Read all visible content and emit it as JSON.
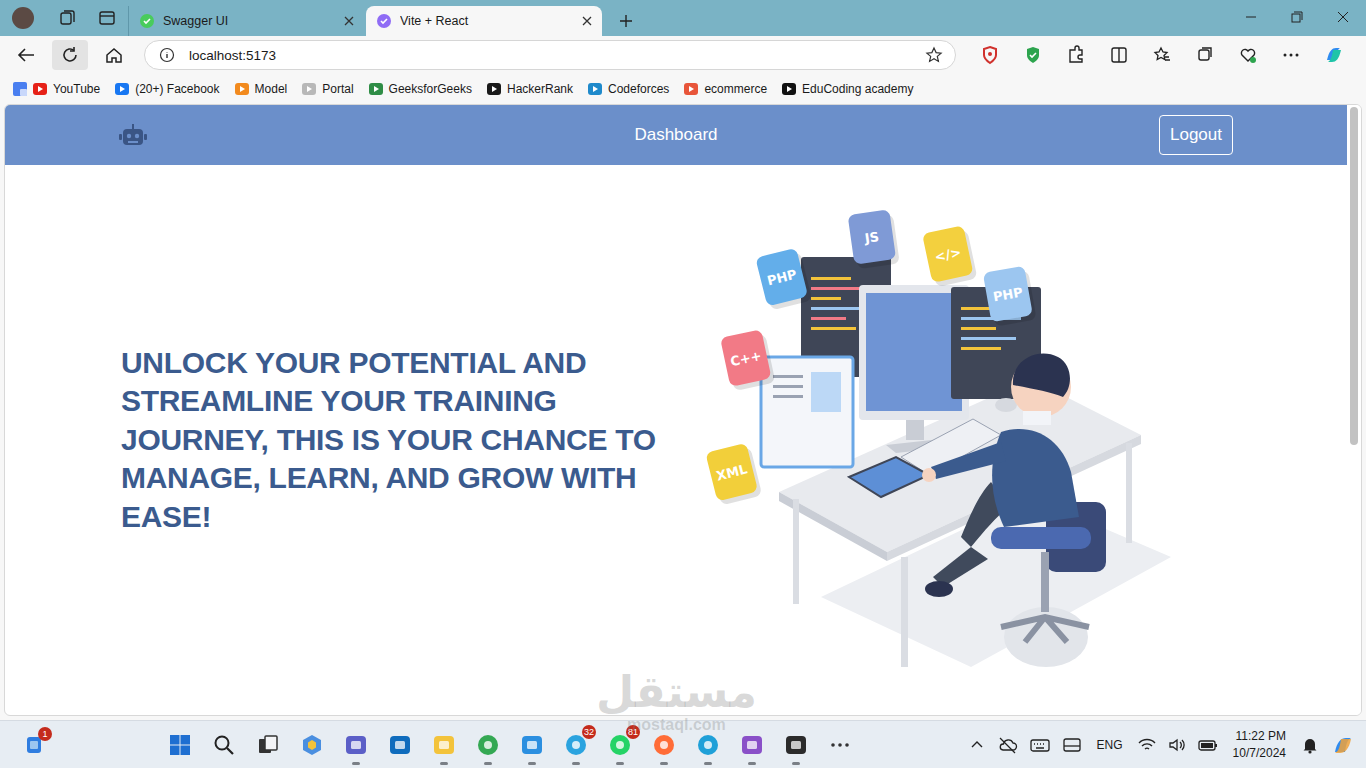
{
  "browser": {
    "tabs": [
      {
        "label": "Swagger UI",
        "selected": false,
        "color": "#49cc5c"
      },
      {
        "label": "Vite + React",
        "selected": true,
        "color": "#8f6cf5"
      }
    ],
    "address": "localhost:5173",
    "bookmarks": [
      {
        "label": "YouTube",
        "color": "#e62117"
      },
      {
        "label": "(20+) Facebook",
        "color": "#1877f2"
      },
      {
        "label": "Model",
        "color": "#f28a1e"
      },
      {
        "label": "Portal",
        "color": "#b8b8b8"
      },
      {
        "label": "GeeksforGeeks",
        "color": "#2f8d46"
      },
      {
        "label": "HackerRank",
        "color": "#1a1a1a"
      },
      {
        "label": "Codeforces",
        "color": "#1f8acb"
      },
      {
        "label": "ecommerce",
        "color": "#e8553a"
      },
      {
        "label": "EduCoding academy",
        "color": "#111111"
      }
    ]
  },
  "page": {
    "nav": {
      "title": "Dashboard",
      "logout": "Logout"
    },
    "hero": {
      "headline": "UNLOCK YOUR POTENTIAL AND STREAMLINE YOUR TRAINING JOURNEY, THIS IS YOUR CHANCE TO MANAGE, LEARN, AND GROW WITH EASE!"
    },
    "illustration": {
      "badges": [
        {
          "label": "JS",
          "color": "#7f9ad6"
        },
        {
          "label": "PHP",
          "color": "#63aeea"
        },
        {
          "label": "</>",
          "color": "#f3d03e"
        },
        {
          "label": "PHP",
          "color": "#9cc6f0"
        },
        {
          "label": "C++",
          "color": "#f27a86"
        },
        {
          "label": "XML",
          "color": "#f2cf3a"
        }
      ]
    }
  },
  "watermark": {
    "arabic": "مستقل",
    "latin": "mostaql.com"
  },
  "taskbar": {
    "widget_badge": "1",
    "apps": [
      {
        "kind": "start",
        "color": "#1f6fd1",
        "badge": "",
        "running": false
      },
      {
        "kind": "search",
        "color": "#222222",
        "badge": "",
        "running": false
      },
      {
        "kind": "taskview",
        "color": "#333333",
        "badge": "",
        "running": false
      },
      {
        "kind": "hex",
        "color": "#4a8fe0",
        "badge": "",
        "running": false
      },
      {
        "kind": "tile",
        "color": "#5b5fc7",
        "badge": "",
        "running": true
      },
      {
        "kind": "tile",
        "color": "#0f6cbd",
        "badge": "",
        "running": false
      },
      {
        "kind": "tile",
        "color": "#f3c33b",
        "badge": "",
        "running": true
      },
      {
        "kind": "round",
        "color": "#34a853",
        "badge": "",
        "running": true
      },
      {
        "kind": "tile",
        "color": "#2b8fe0",
        "badge": "",
        "running": true
      },
      {
        "kind": "round",
        "color": "#2aa3df",
        "badge": "32",
        "running": true
      },
      {
        "kind": "round",
        "color": "#25d366",
        "badge": "81",
        "running": true
      },
      {
        "kind": "round",
        "color": "#ff6c37",
        "badge": "",
        "running": true
      },
      {
        "kind": "round",
        "color": "#1fa0d8",
        "badge": "",
        "running": true
      },
      {
        "kind": "tile",
        "color": "#8a50c8",
        "badge": "",
        "running": true
      },
      {
        "kind": "tile",
        "color": "#2b2b2b",
        "badge": "",
        "running": true
      },
      {
        "kind": "more",
        "color": "#333333",
        "badge": "",
        "running": false
      }
    ],
    "language": "ENG",
    "time": "11:22 PM",
    "date": "10/7/2024"
  }
}
